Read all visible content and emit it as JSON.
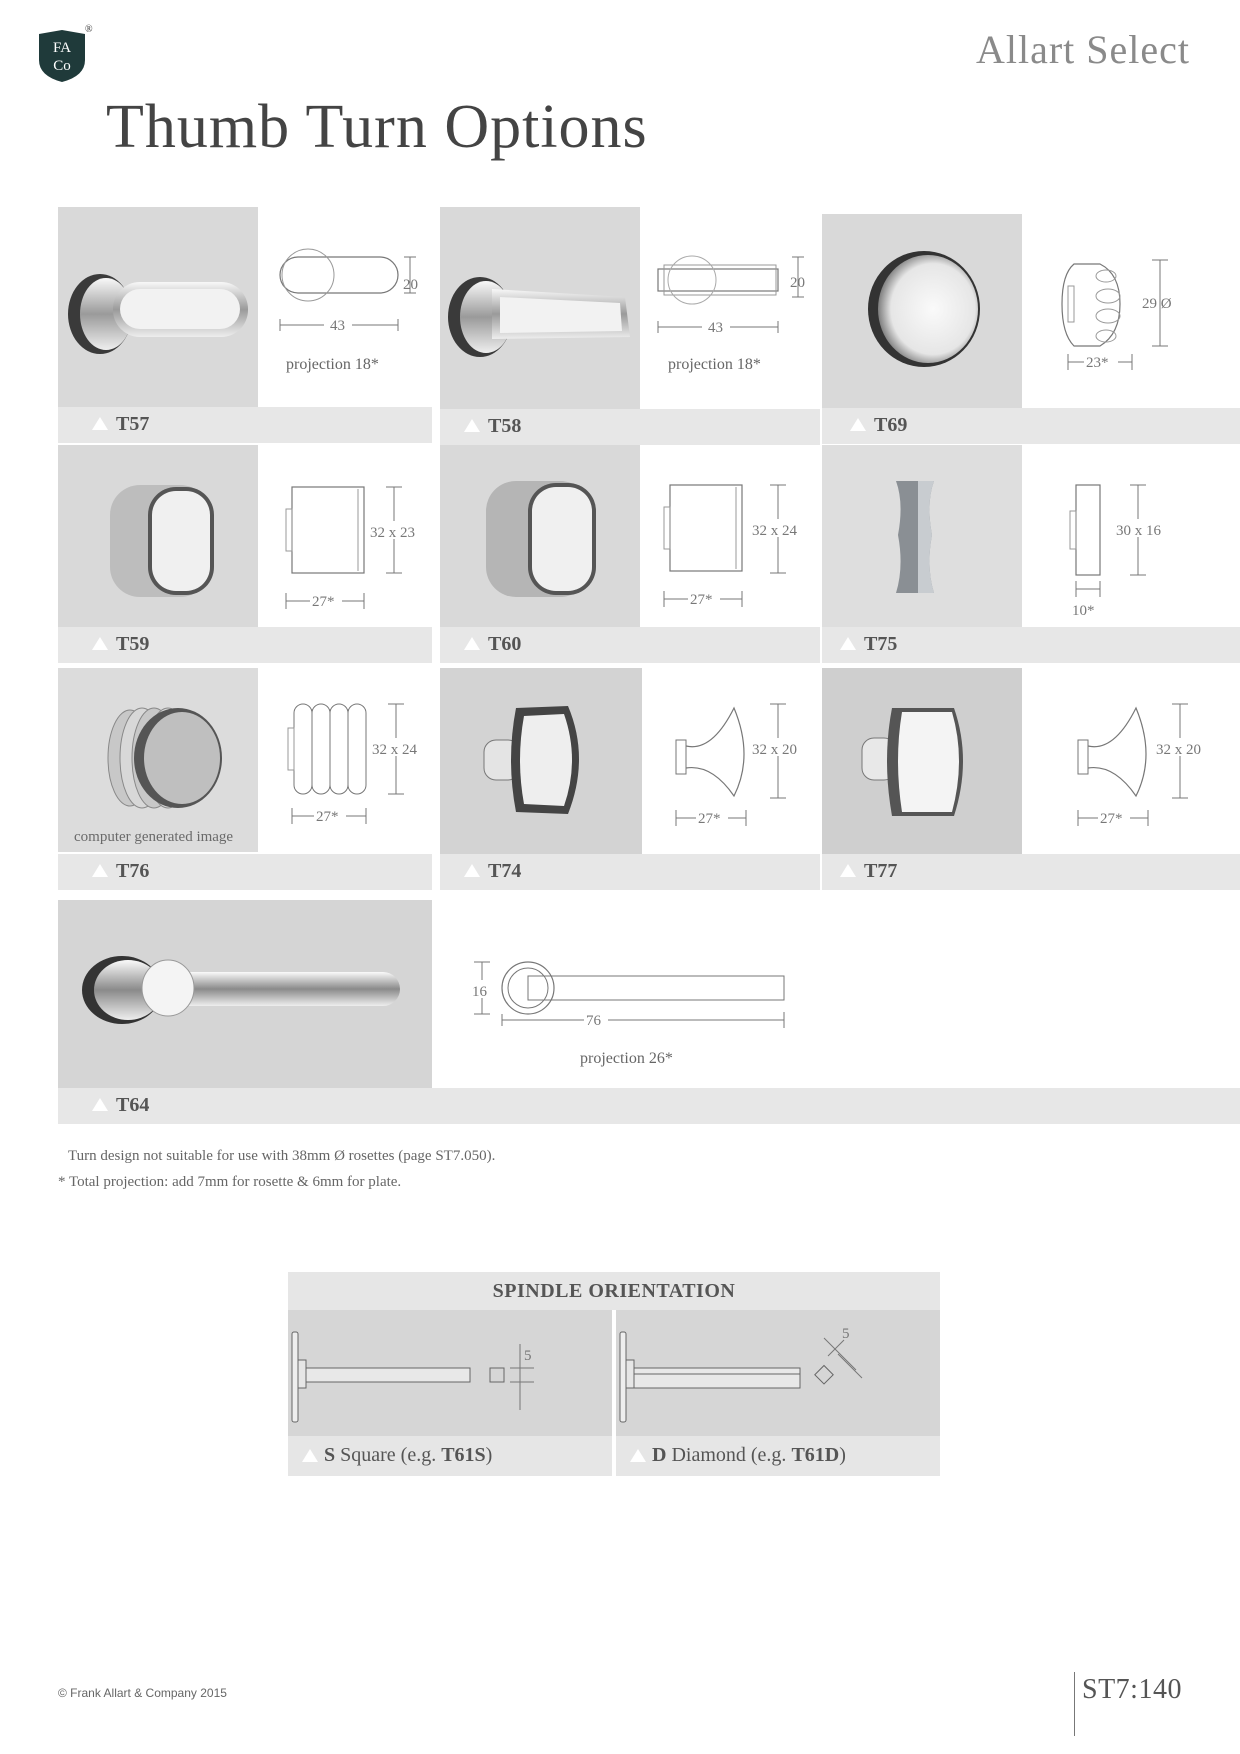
{
  "header": {
    "logo_text_top": "FA",
    "logo_text_bottom": "Co",
    "logo_registered": "®",
    "brand": "Allart Select",
    "title": "Thumb Turn Options"
  },
  "products": [
    {
      "code": "T57",
      "dims": [
        "20",
        "43"
      ],
      "projection": "projection 18*"
    },
    {
      "code": "T58",
      "dims": [
        "20",
        "43"
      ],
      "projection": "projection 18*"
    },
    {
      "code": "T69",
      "dims": [
        "29 Ø",
        "23*"
      ]
    },
    {
      "code": "T59",
      "dims": [
        "32 x 23",
        "27*"
      ]
    },
    {
      "code": "T60",
      "dims": [
        "32 x 24",
        "27*"
      ]
    },
    {
      "code": "T75",
      "dims": [
        "30 x 16",
        "10*"
      ]
    },
    {
      "code": "T76",
      "dims": [
        "32 x 24",
        "27*"
      ],
      "photo_caption": "computer generated image"
    },
    {
      "code": "T74",
      "dims": [
        "32 x 20",
        "27*"
      ]
    },
    {
      "code": "T77",
      "dims": [
        "32 x 20",
        "27*"
      ]
    },
    {
      "code": "T64",
      "dims": [
        "16",
        "76"
      ],
      "projection": "projection 26*"
    }
  ],
  "notes": [
    "Turn design not suitable for use with 38mm Ø rosettes (page ST7.050).",
    "* Total projection: add 7mm for rosette & 6mm for plate."
  ],
  "spindle": {
    "title": "SPINDLE ORIENTATION",
    "square": {
      "letter": "S",
      "label": "Square (e.g.",
      "example": "T61S",
      "close": ")",
      "dim": "5"
    },
    "diamond": {
      "letter": "D",
      "label": "Diamond (e.g.",
      "example": "T61D",
      "close": ")",
      "dim": "5"
    }
  },
  "footer": {
    "copyright": "© Frank Allart & Company 2015",
    "page": "ST7:140"
  }
}
